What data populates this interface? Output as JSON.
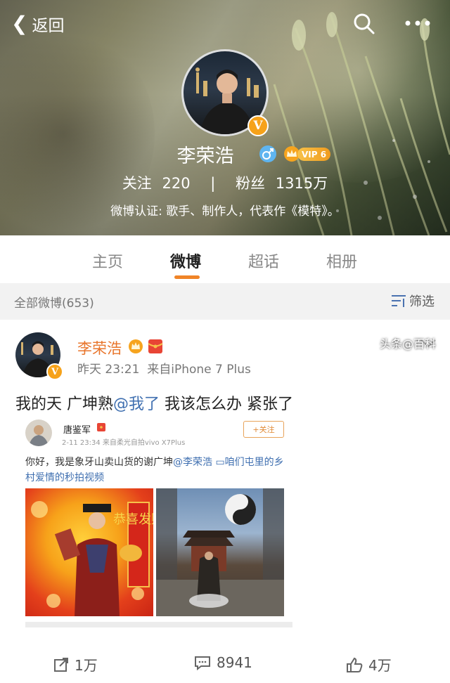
{
  "nav": {
    "back_label": "返回",
    "search_icon": "search-icon",
    "more_icon": "more-icon"
  },
  "profile": {
    "name": "李荣浩",
    "vip_label": "VIP 6",
    "following_label": "关注",
    "following_count": "220",
    "separator": "|",
    "followers_label": "粉丝",
    "followers_count": "1315万",
    "verified_text": "微博认证: 歌手、制作人，代表作《模特》。"
  },
  "tabs": [
    {
      "label": "主页"
    },
    {
      "label": "微博"
    },
    {
      "label": "超话"
    },
    {
      "label": "相册"
    }
  ],
  "filter": {
    "count_label": "全部微博(653)",
    "filter_label": "筛选"
  },
  "post": {
    "author": "李荣浩",
    "time": "昨天 23:21",
    "source": "来自iPhone 7 Plus",
    "text_before": "我的天 广坤熟",
    "mention": "@我了",
    "text_after": " 我该怎么办 紧张了",
    "repost": {
      "author": "唐鉴军",
      "meta": "2-11 23:34  来自柔光自拍vivo X7Plus",
      "follow_label": "+关注",
      "text_before": "你好，我是象牙山卖山货的谢广坤",
      "mention": "@李荣浩",
      "link": " ▭咱们屯里的乡村爱情的秒拍视频",
      "img1_text": "恭喜发财"
    },
    "actions": {
      "repost_count": "1万",
      "comment_count": "8941",
      "like_count": "4万"
    }
  },
  "watermark": "头条@百科"
}
